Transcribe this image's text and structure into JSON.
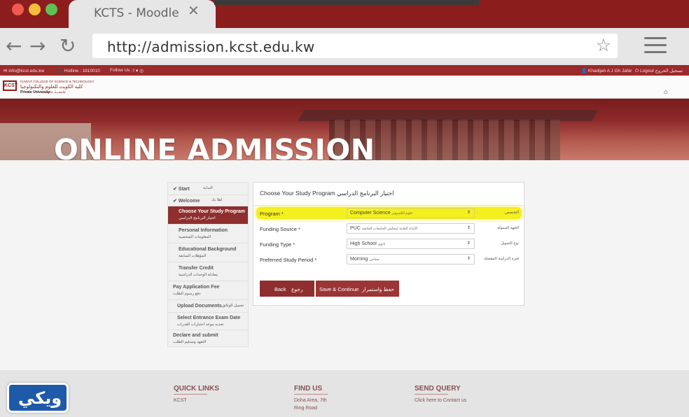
{
  "browser": {
    "tab_title": "KCTS - Moodle",
    "tab_close": "✕",
    "url": "http://admission.kcst.edu.kw",
    "back_icon": "arrow-left-icon",
    "forward_icon": "arrow-right-icon",
    "reload_icon": "reload-icon",
    "star_icon": "☆",
    "colors": {
      "close": "#f05a50",
      "minimize": "#f6be3a",
      "maximize": "#5fbf55",
      "frame": "#8c1d1d"
    }
  },
  "topbar": {
    "email": "✉ info@kcst.edu.kw",
    "hotline": "📞 Hotline : 1810010",
    "follow": "Follow Us :",
    "social": "f ♥ ◎",
    "user": "👤 Khadijah A J Gh Jafar",
    "logout": "⏻ Logout تسجيل الخروج"
  },
  "logo": {
    "mark": "KCST",
    "name_en": "KUWAIT COLLEGE OF SCIENCE & TECHNOLOGY",
    "name_ar": "كلية الكويت للعلوم والتكنولوجيا",
    "private_en": "Private University",
    "private_ar": "جامعـــة خاصـــة"
  },
  "hero": {
    "title": "ONLINE ADMISSION"
  },
  "sidebar": {
    "items": [
      {
        "en": "✔ Start",
        "ar": "البداية"
      },
      {
        "en": "✔ Welcome",
        "ar": "اهلا بك"
      },
      {
        "en": "Choose Your Study Program",
        "ar": "اختيار البرنامج الدراسي"
      },
      {
        "en": "Personal Information",
        "ar": "المعلومات الشخصية"
      },
      {
        "en": "Educational Background",
        "ar": "المؤهلات السابقة"
      },
      {
        "en": "Transfer Credit",
        "ar": "معادلة الوحدات الدراسية"
      },
      {
        "en": "Pay Application Fee",
        "ar": "دفع رسوم الطلب"
      },
      {
        "en": "Upload Documents",
        "ar": "تحميل الوثائق"
      },
      {
        "en": "Select Entrance Exam Date",
        "ar": "تحديد موعد اختبارات القدرات"
      },
      {
        "en": "Declare and submit",
        "ar": "التعهد وتسليم الطلب"
      }
    ]
  },
  "form": {
    "title": "Choose Your Study Program اختيار البرنامج الدراسي",
    "rows": [
      {
        "label": "Program *",
        "value": "Computer Science",
        "value_ar": "علوم الكمبيوتر",
        "label_ar": "التخصص"
      },
      {
        "label": "Funding Source *",
        "value": "PUC",
        "value_ar": "الأمانة العامة لمجلس الجامعات الخاصة",
        "label_ar": "الجهة الممولة"
      },
      {
        "label": "Funding Type *",
        "value": "High School",
        "value_ar": "ثانوي",
        "label_ar": "نوع التمويل"
      },
      {
        "label": "Preferred Study Period *",
        "value": "Morning",
        "value_ar": "صباحي",
        "label_ar": "فترة الدراسة المفضلة"
      }
    ],
    "back_label": "Back",
    "back_ar": "رجوع",
    "save_label": "Save & Continue",
    "save_ar": "حفظ واستمرار",
    "highlight_color": "#f4ef1e"
  },
  "footer": {
    "quick_links": "QUICK LINKS",
    "quick_links_item": "KCST",
    "find_us": "FIND US",
    "find_us_line1": "Doha Area, 7th",
    "find_us_line2": "Ring Road",
    "send_query": "SEND QUERY",
    "send_query_link": "Click here to Contact us"
  },
  "watermark": {
    "text": "ويكي"
  }
}
